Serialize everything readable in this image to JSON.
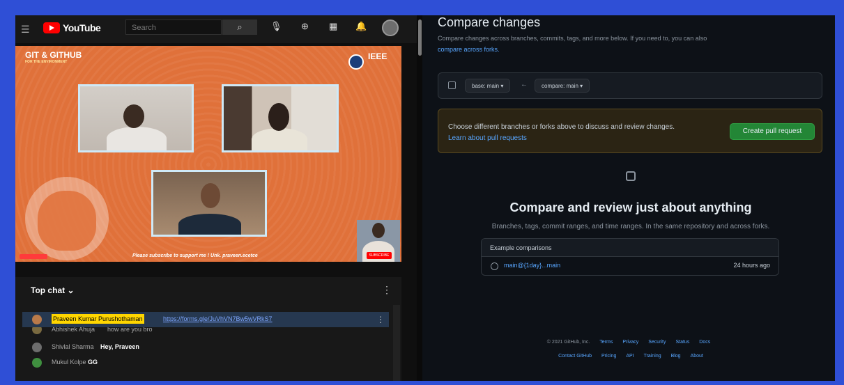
{
  "youtube": {
    "brand": "YouTube",
    "search_placeholder": "Search",
    "video": {
      "title": "GIT & GITHUB",
      "subtitle": "FOR THE ENVIRONMENT",
      "org": "IEEE",
      "caption": "Please subscribe to support me ! Unk. praveen.ecetce",
      "subscribe": "SUBSCRIBE"
    },
    "chat": {
      "header": "Top chat",
      "rows": [
        {
          "name": "Praveen Kumar Purushothaman",
          "link": "https://forms.gle/JuVhVN7Bw5wVRkS7",
          "pinned": true
        },
        {
          "name": "Abhishek Ahuja",
          "msg": "how are you bro"
        },
        {
          "name": "Shivlal Sharma",
          "msg": "Hey, Praveen"
        },
        {
          "name": "Mukul Kolpe",
          "msg": "GG"
        }
      ]
    }
  },
  "github": {
    "title": "Compare changes",
    "desc": "Compare changes across branches, commits, tags, and more below. If you need to, you can also",
    "desc_link": "compare across forks.",
    "base_label": "base: main ▾",
    "compare_label": "compare: main ▾",
    "arrow": "←",
    "flash_text": "Choose different branches or forks above to discuss and review changes.",
    "flash_link": "Learn about pull requests",
    "pr_button": "Create pull request",
    "blank_title": "Compare and review just about anything",
    "blank_desc": "Branches, tags, commit ranges, and time ranges. In the same repository and across forks.",
    "examples_header": "Example comparisons",
    "example_link": "main@{1day}...main",
    "example_time": "24 hours ago",
    "footer_copy": "© 2021 GitHub, Inc.",
    "footer_row1": [
      "Terms",
      "Privacy",
      "Security",
      "Status",
      "Docs"
    ],
    "footer_row2": [
      "Contact GitHub",
      "Pricing",
      "API",
      "Training",
      "Blog",
      "About"
    ]
  }
}
